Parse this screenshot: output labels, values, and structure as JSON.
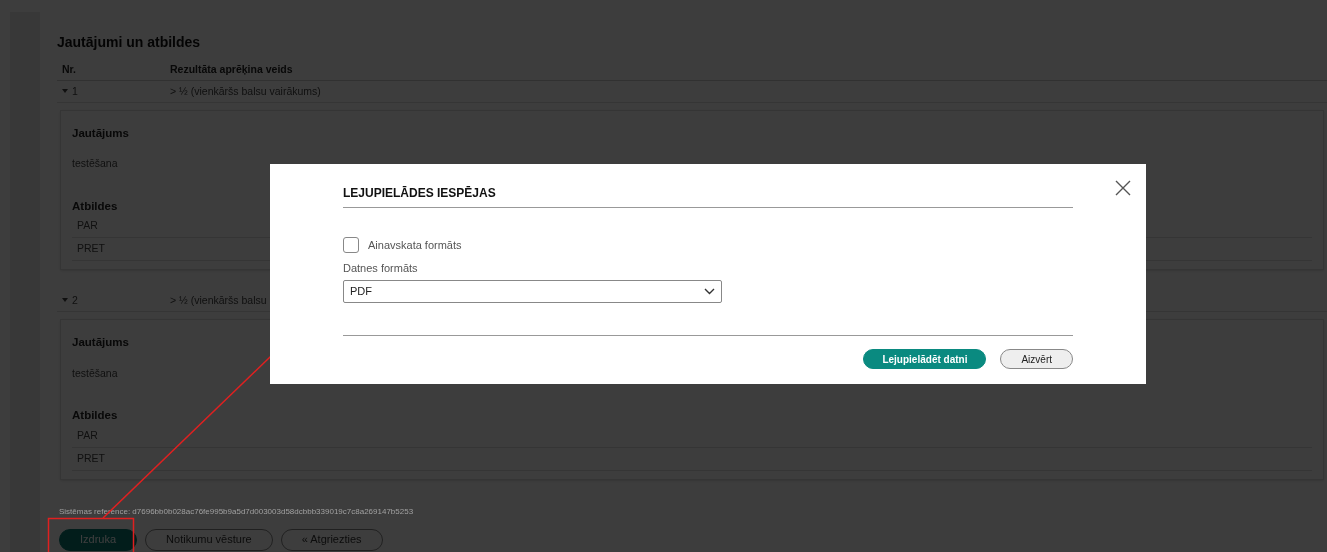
{
  "section_title": "Jautājumi un atbildes",
  "columns": [
    "Nr.",
    "Rezultāta aprēķina veids"
  ],
  "questions": [
    {
      "number": "1",
      "method": "> ½ (vienkāršs balsu vairākums)",
      "expanded": true,
      "question_label": "Jautājums",
      "question_text": "testēšana",
      "answers_label": "Atbildes",
      "answers": [
        "PAR",
        "PRET"
      ]
    },
    {
      "number": "2",
      "method": "> ½ (vienkāršs balsu",
      "expanded": true,
      "question_label": "Jautājums",
      "question_text": "testēšana",
      "answers_label": "Atbildes",
      "answers": [
        "PAR",
        "PRET"
      ]
    }
  ],
  "system_reference": "Sistēmas reference: d7696bb0b028ac76fe995b9a5d7d003003d58dcbbb339019c7c8a269147b5253",
  "actions": [
    {
      "label": "Izdruka",
      "kind": "primary"
    },
    {
      "label": "Notikumu vēsture",
      "kind": "secondary"
    },
    {
      "label": "« Atgriezties",
      "kind": "secondary"
    }
  ],
  "dialog": {
    "title": "LEJUPIELĀDES IESPĒJAS",
    "landscape": {
      "label": "Ainavskata formāts",
      "checked": false
    },
    "file_format": {
      "label": "Datnes formāts",
      "value": "PDF"
    },
    "buttons": [
      {
        "label": "Lejupielādēt datni",
        "kind": "primary"
      },
      {
        "label": "Aizvērt",
        "kind": "secondary"
      }
    ]
  }
}
